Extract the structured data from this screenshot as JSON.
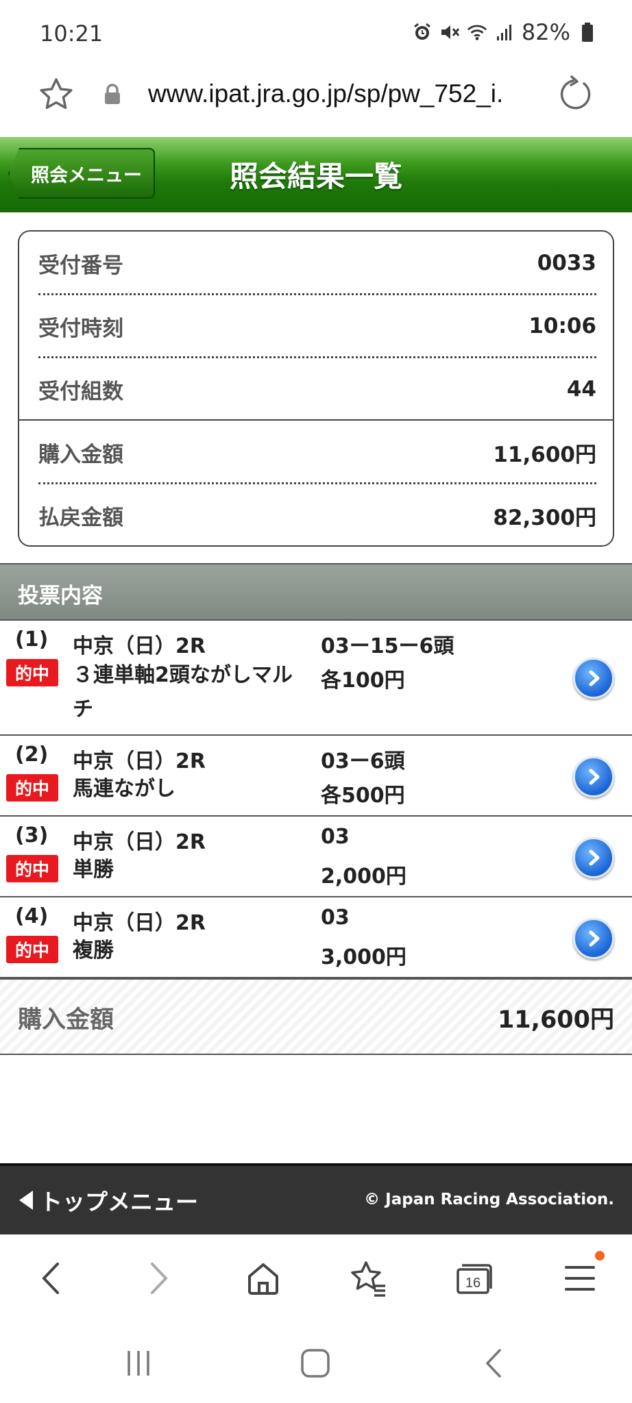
{
  "status_bar": {
    "time": "10:21",
    "battery": "82%",
    "icons": [
      "alarm-icon",
      "mute-icon",
      "wifi-icon",
      "signal-icon",
      "battery-icon"
    ]
  },
  "address_bar": {
    "url": "www.ipat.jra.go.jp/sp/pw_752_i.",
    "icons": [
      "star-icon",
      "lock-icon",
      "reload-icon"
    ]
  },
  "header": {
    "back_label": "照会メニュー",
    "title": "照会結果一覧",
    "accent": "#1f7a0a"
  },
  "summary": {
    "rows": [
      {
        "label": "受付番号",
        "value": "0033"
      },
      {
        "label": "受付時刻",
        "value": "10:06"
      },
      {
        "label": "受付組数",
        "value": "44"
      },
      {
        "label": "購入金額",
        "value": "11,600円"
      },
      {
        "label": "払戻金額",
        "value": "82,300円"
      }
    ]
  },
  "section": {
    "title": "投票内容"
  },
  "bets": [
    {
      "num": "(1)",
      "badge": "的中",
      "race": "中京（日）2R",
      "combo": "03ー15ー6頭",
      "type_line1": "３連単軸2頭ながしマル",
      "type_line2": "チ",
      "amount": "各100円"
    },
    {
      "num": "(2)",
      "badge": "的中",
      "race": "中京（日）2R",
      "combo": "03ー6頭",
      "type_line1": "馬連ながし",
      "amount": "各500円"
    },
    {
      "num": "(3)",
      "badge": "的中",
      "race": "中京（日）2R",
      "combo": "03",
      "type_line1": "単勝",
      "amount": "2,000円"
    },
    {
      "num": "(4)",
      "badge": "的中",
      "race": "中京（日）2R",
      "combo": "03",
      "type_line1": "複勝",
      "amount": "3,000円"
    }
  ],
  "total": {
    "label": "購入金額",
    "value": "11,600円"
  },
  "footer": {
    "top_menu": "トップメニュー",
    "copyright": "© Japan Racing Association."
  },
  "browser_nav": {
    "tab_count": "16",
    "icons": [
      "back-icon",
      "forward-icon",
      "home-icon",
      "bookmarks-icon",
      "tabs-icon",
      "menu-icon"
    ]
  },
  "colors": {
    "hit_badge": "#e8191f",
    "arrow_button": "#1a64d6",
    "footer_bg": "#333333"
  }
}
